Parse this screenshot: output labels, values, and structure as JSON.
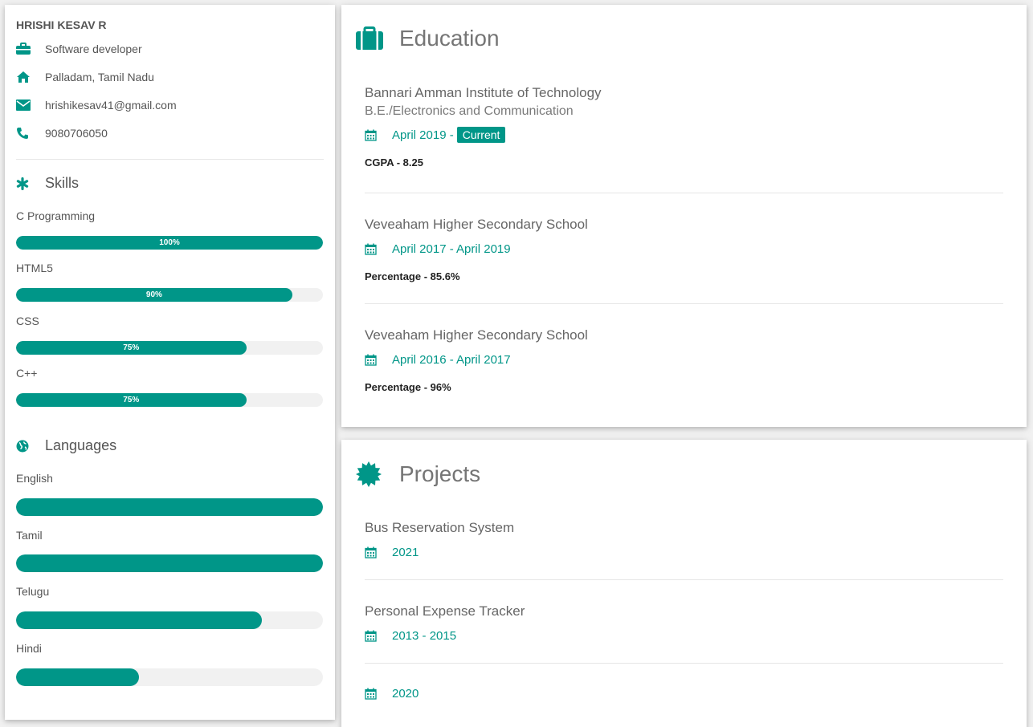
{
  "profile": {
    "name": "HRISHI KESAV R",
    "title": "Software developer",
    "location": "Palladam, Tamil Nadu",
    "email": "hrishikesav41@gmail.com",
    "phone": "9080706050"
  },
  "skills": {
    "heading": "Skills",
    "items": [
      {
        "label": "C Programming",
        "percent": 100,
        "text": "100%"
      },
      {
        "label": "HTML5",
        "percent": 90,
        "text": "90%"
      },
      {
        "label": "CSS",
        "percent": 75,
        "text": "75%"
      },
      {
        "label": "C++",
        "percent": 75,
        "text": "75%"
      }
    ]
  },
  "languages": {
    "heading": "Languages",
    "items": [
      {
        "label": "English",
        "percent": 100
      },
      {
        "label": "Tamil",
        "percent": 100
      },
      {
        "label": "Telugu",
        "percent": 80
      },
      {
        "label": "Hindi",
        "percent": 40
      }
    ]
  },
  "education": {
    "heading": "Education",
    "entries": [
      {
        "institution": "Bannari Amman Institute of Technology",
        "degree": "B.E./Electronics and Communication",
        "dates": "April 2019 -",
        "badge": "Current",
        "detail": "CGPA - 8.25"
      },
      {
        "institution": "Veveaham Higher Secondary School",
        "dates": "April 2017 - April 2019",
        "detail": "Percentage - 85.6%"
      },
      {
        "institution": "Veveaham Higher Secondary School",
        "dates": "April 2016 - April 2017",
        "detail": "Percentage - 96%"
      }
    ]
  },
  "projects": {
    "heading": "Projects",
    "entries": [
      {
        "title": "Bus Reservation System",
        "dates": "2021"
      },
      {
        "title": "Personal Expense Tracker",
        "dates": "2013 - 2015"
      },
      {
        "title": "",
        "dates": "2020"
      }
    ]
  },
  "colors": {
    "accent": "#009688",
    "track": "#f1f1f1"
  }
}
